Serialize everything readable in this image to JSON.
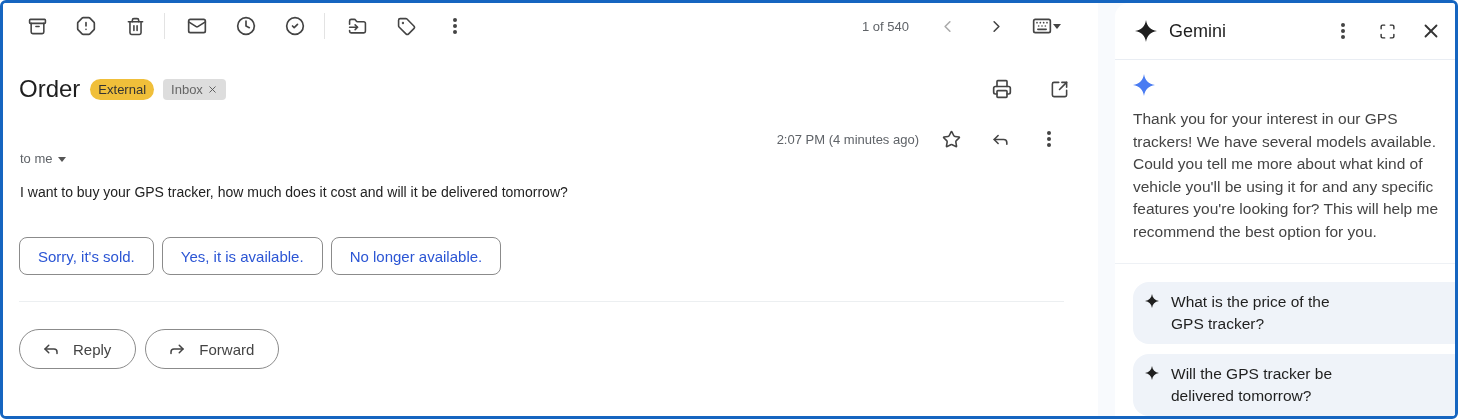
{
  "toolbar": {
    "counter": "1 of 540"
  },
  "subject": {
    "title": "Order",
    "labels": [
      {
        "text": "External",
        "kind": "badge"
      },
      {
        "text": "Inbox",
        "kind": "removable"
      }
    ]
  },
  "message": {
    "time": "2:07 PM (4 minutes ago)",
    "recipient": "to me",
    "body": "I want to buy your GPS tracker, how much does it cost and will it be delivered tomorrow?",
    "smart_replies": [
      "Sorry, it's sold.",
      "Yes, it is available.",
      "No longer available."
    ]
  },
  "actions": [
    {
      "label": "Reply",
      "kind": "reply"
    },
    {
      "label": "Forward",
      "kind": "forward"
    }
  ],
  "gemini": {
    "title": "Gemini",
    "response": "Thank you for your interest in our GPS trackers! We have several models available. Could you tell me more about what kind of vehicle you'll be using it for and any specific features you're looking for? This will help me recommend the best option for you.",
    "suggestions": [
      "What is the price of the GPS tracker?",
      "Will the GPS tracker be delivered tomorrow?"
    ]
  }
}
